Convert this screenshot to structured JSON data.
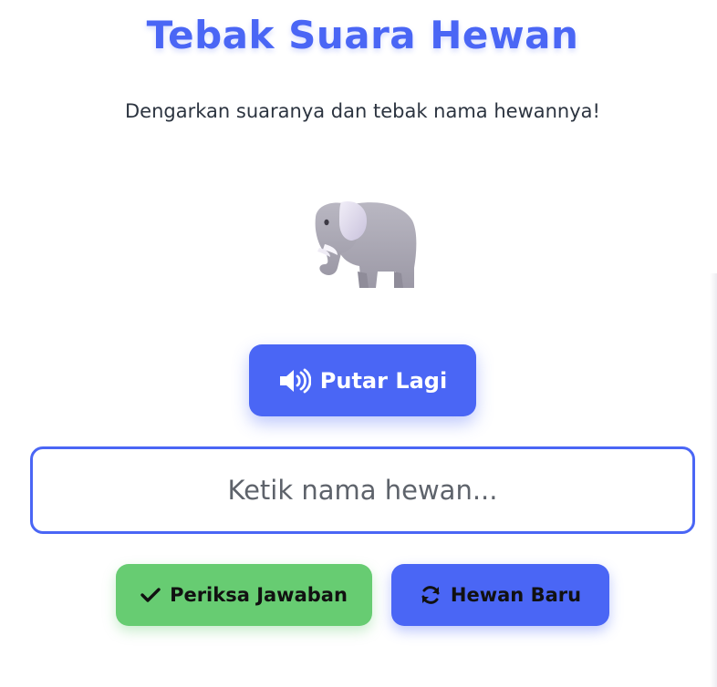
{
  "header": {
    "title": "Tebak Suara Hewan",
    "subtitle": "Dengarkan suaranya dan tebak nama hewannya!"
  },
  "animal": {
    "icon": "elephant-icon"
  },
  "play": {
    "label": "Putar Lagi",
    "icon": "speaker-icon"
  },
  "answer": {
    "value": "",
    "placeholder": "Ketik nama hewan..."
  },
  "actions": {
    "check_label": "Periksa Jawaban",
    "check_icon": "checkmark-icon",
    "new_label": "Hewan Baru",
    "new_icon": "refresh-icon"
  },
  "colors": {
    "primary": "#4a66f5",
    "success": "#67cc72",
    "text": "#2c3440"
  }
}
